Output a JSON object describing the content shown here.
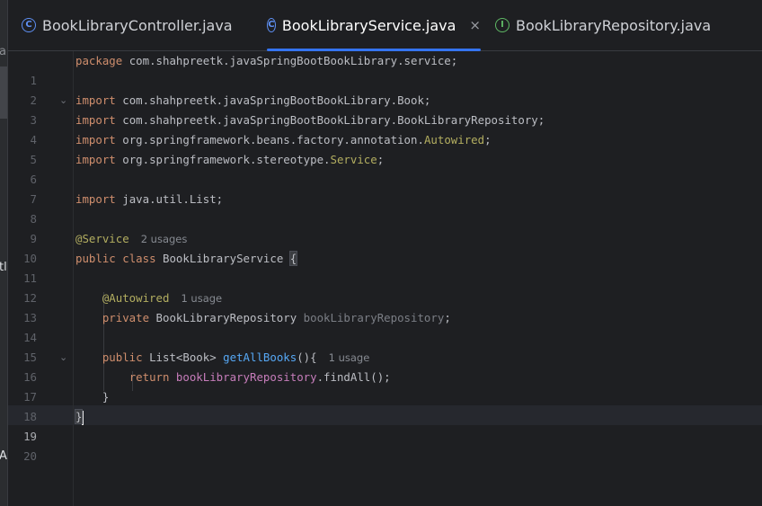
{
  "left_pane": {
    "fragments": [
      "ar",
      "tl",
      "A"
    ]
  },
  "tabs": [
    {
      "label": "BookLibraryController.java",
      "icon": "class-icon",
      "active": false
    },
    {
      "label": "BookLibraryService.java",
      "icon": "class-icon",
      "active": true,
      "close": "×"
    },
    {
      "label": "BookLibraryRepository.java",
      "icon": "interface-icon",
      "active": false
    }
  ],
  "icons": {
    "class_glyph": "C",
    "interface_glyph": "I"
  },
  "editor": {
    "current_line": 19,
    "line_numbers": [
      "1",
      "2",
      "3",
      "4",
      "5",
      "6",
      "7",
      "8",
      "9",
      "10",
      "11",
      "12",
      "13",
      "14",
      "15",
      "16",
      "17",
      "18",
      "19",
      "20"
    ],
    "tokens": {
      "package_kw": "package",
      "package_name": "com.shahpreetk.javaSpringBootBookLibrary.service;",
      "import_kw": "import",
      "imp3": "com.shahpreetk.javaSpringBootBookLibrary.Book;",
      "imp4": "com.shahpreetk.javaSpringBootBookLibrary.BookLibraryRepository;",
      "imp5_pre": "org.springframework.beans.factory.annotation.",
      "imp5_cls": "Autowired",
      "imp6_pre": "org.springframework.stereotype.",
      "imp6_cls": "Service",
      "semi": ";",
      "imp8": "java.util.List;",
      "ann_service": "@Service",
      "hint_2usages": "2 usages",
      "public_kw": "public",
      "class_kw": "class",
      "class_name": "BookLibraryService",
      "open_brace": "{",
      "ann_autowired": "@Autowired",
      "hint_1usage": "1 usage",
      "private_kw": "private",
      "repo_type": "BookLibraryRepository",
      "repo_field": "bookLibraryRepository",
      "list_type": "List<Book>",
      "method_name": "getAllBooks",
      "method_sig": "(){",
      "return_kw": "return",
      "call": ".findAll();",
      "close_brace": "}"
    }
  },
  "colors": {
    "background": "#1e1f22",
    "keyword": "#cf8e6d",
    "annotation": "#b3ae60",
    "method": "#56a8f5",
    "field": "#c77dbb",
    "accent": "#3574f0"
  }
}
